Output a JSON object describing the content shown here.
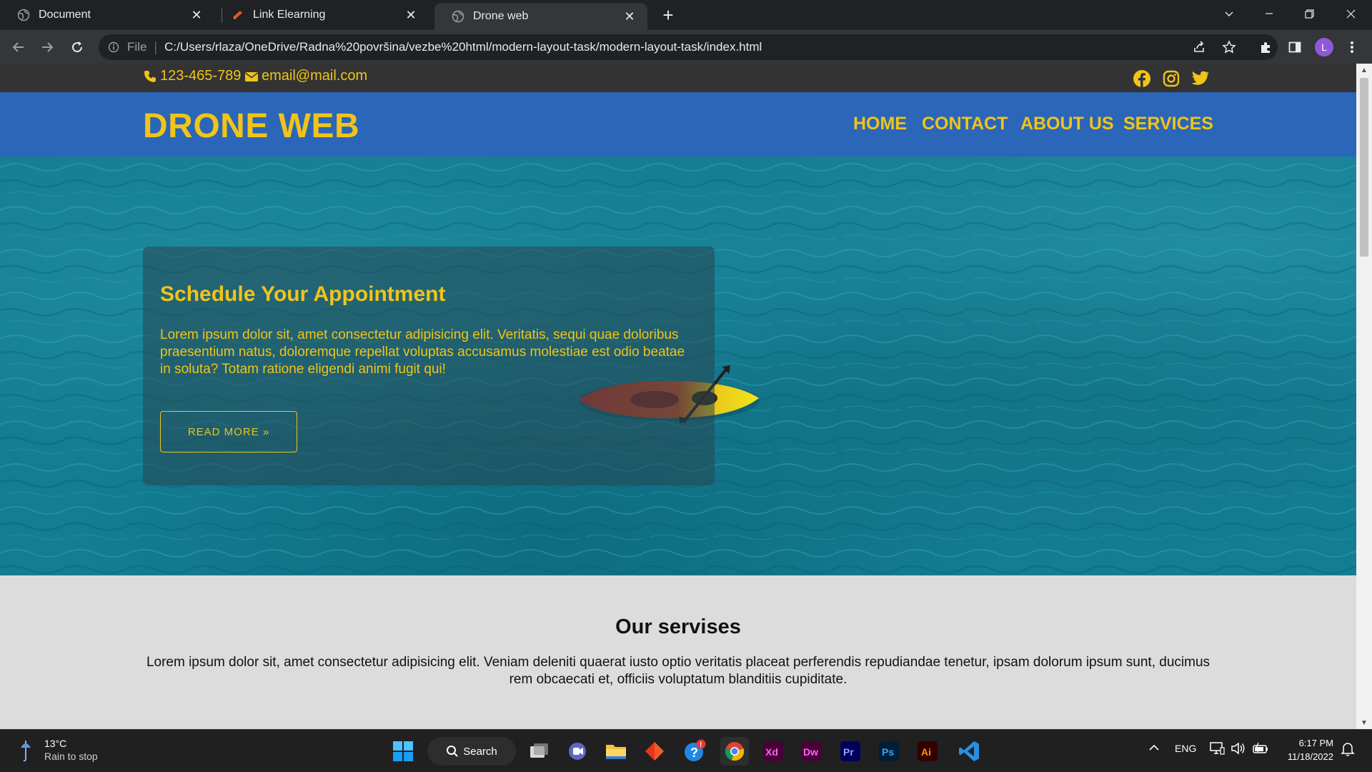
{
  "browser": {
    "tabs": [
      {
        "title": "Document",
        "icon": "globe-icon"
      },
      {
        "title": "Link Elearning",
        "icon": "link-favicon-icon"
      },
      {
        "title": "Drone web",
        "icon": "globe-icon",
        "active": true
      }
    ],
    "address": {
      "scheme": "File",
      "url": "C:/Users/rlaza/OneDrive/Radna%20površina/vezbe%20html/modern-layout-task/modern-layout-task/index.html"
    },
    "profile_initial": "L"
  },
  "page": {
    "topbar": {
      "phone": "123-465-789",
      "email": "email@mail.com",
      "social_icons": [
        "facebook-icon",
        "instagram-icon",
        "twitter-icon"
      ]
    },
    "nav": {
      "brand": "DRONE WEB",
      "links": [
        "HOME",
        "CONTACT",
        "ABOUT US",
        "SERVICES"
      ]
    },
    "hero": {
      "title": "Schedule Your Appointment",
      "text": "Lorem ipsum dolor sit, amet consectetur adipisicing elit. Veritatis, sequi quae doloribus praesentium natus, doloremque repellat voluptas accusamus molestiae est odio beatae in soluta? Totam ratione eligendi animi fugit qui!",
      "button": "READ MORE »"
    },
    "services": {
      "title": "Our servises",
      "text": "Lorem ipsum dolor sit, amet consectetur adipisicing elit. Veniam deleniti quaerat iusto optio veritatis placeat perferendis repudiandae tenetur, ipsam dolorum ipsum sunt, ducimus rem obcaecati et, officiis voluptatum blanditiis cupiditate."
    }
  },
  "colors": {
    "accent": "#f0c419",
    "nav_bg": "#2b66b8",
    "topbar_bg": "#333333",
    "hero_water": "#137d92"
  },
  "taskbar": {
    "weather": {
      "temp": "13°C",
      "condition": "Rain to stop"
    },
    "search_label": "Search",
    "apps": [
      "windows-start-icon",
      "search-icon",
      "task-view-icon",
      "teams-icon",
      "file-explorer-icon",
      "git-icon",
      "help-icon",
      "chrome-icon",
      "xd-icon",
      "dreamweaver-icon",
      "premiere-icon",
      "photoshop-icon",
      "illustrator-icon",
      "vscode-icon"
    ],
    "app_labels": {
      "xd": "Xd",
      "dw": "Dw",
      "pr": "Pr",
      "ps": "Ps",
      "ai": "Ai"
    },
    "language": "ENG",
    "time": "6:17 PM",
    "date": "11/18/2022"
  }
}
